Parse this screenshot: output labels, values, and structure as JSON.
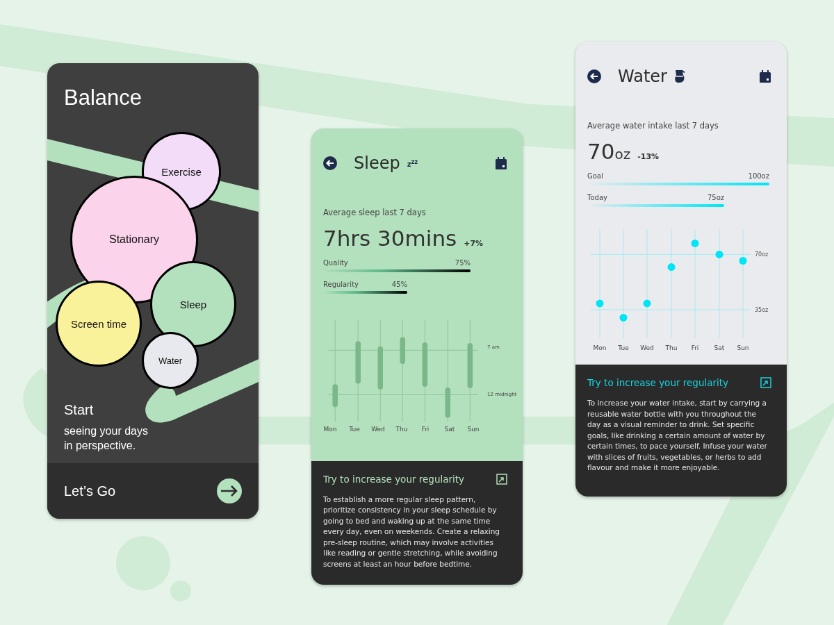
{
  "balance": {
    "title": "Balance",
    "bubbles": [
      {
        "label": "Exercise",
        "color": "#f3dcf7"
      },
      {
        "label": "Stationary",
        "color": "#fbd3ea"
      },
      {
        "label": "Sleep",
        "color": "#b3e0bd"
      },
      {
        "label": "Screen time",
        "color": "#faf29a"
      },
      {
        "label": "Water",
        "color": "#e8e9ee"
      }
    ],
    "heading": "Start",
    "subtitle": "seeing your days\nin perspective.",
    "cta": "Let’s Go"
  },
  "sleep": {
    "title": "Sleep",
    "title_icon": "z$^{z}$$^{z}$",
    "summary_label": "Average sleep last 7 days",
    "value": "7hrs 30mins",
    "change": "+7%",
    "metrics": [
      {
        "label": "Quality",
        "reading": "75%"
      },
      {
        "label": "Regularity",
        "reading": "45%"
      }
    ],
    "chart": {
      "days": [
        "Mon",
        "Tue",
        "Wed",
        "Thu",
        "Fri",
        "Sat",
        "Sun"
      ],
      "ticks": [
        "7 am",
        "12 midnight"
      ]
    },
    "tip": {
      "title": "Try to increase your regularity",
      "text": "To establish a more regular sleep pattern, prioritize consistency in your sleep schedule by going to bed and waking up at the same time every day, even on weekends. Create a relaxing pre-sleep routine, which may involve activities like reading or gentle stretching, while avoiding screens at least an hour before bedtime."
    }
  },
  "water": {
    "title": "Water",
    "summary_label": "Average water intake last 7 days",
    "value": "70",
    "unit": "oz",
    "change": "-13%",
    "metrics": [
      {
        "label": "Goal",
        "reading": "100oz"
      },
      {
        "label": "Today",
        "reading": "75oz"
      }
    ],
    "chart_data": {
      "type": "scatter",
      "categories": [
        "Mon",
        "Tue",
        "Wed",
        "Thu",
        "Fri",
        "Sat",
        "Sun"
      ],
      "grid": true,
      "series": [
        {
          "color": "#00e5f5",
          "values": [
            39,
            30,
            39,
            62,
            77,
            70,
            66
          ]
        }
      ],
      "ylim": [
        17,
        86
      ],
      "yticks": [
        {
          "value": 35,
          "label": "35oz"
        },
        {
          "value": 70,
          "label": "70oz"
        }
      ]
    },
    "tip": {
      "title": "Try to increase your regularity",
      "text": "To increase your water intake, start by carrying a reusable water bottle with you throughout the day as a visual reminder to drink. Set specific goals, like drinking a certain amount of water by certain times, to pace yourself. Infuse your water with slices of fruits, vegetables, or herbs to add flavour and make it more enjoyable."
    }
  }
}
